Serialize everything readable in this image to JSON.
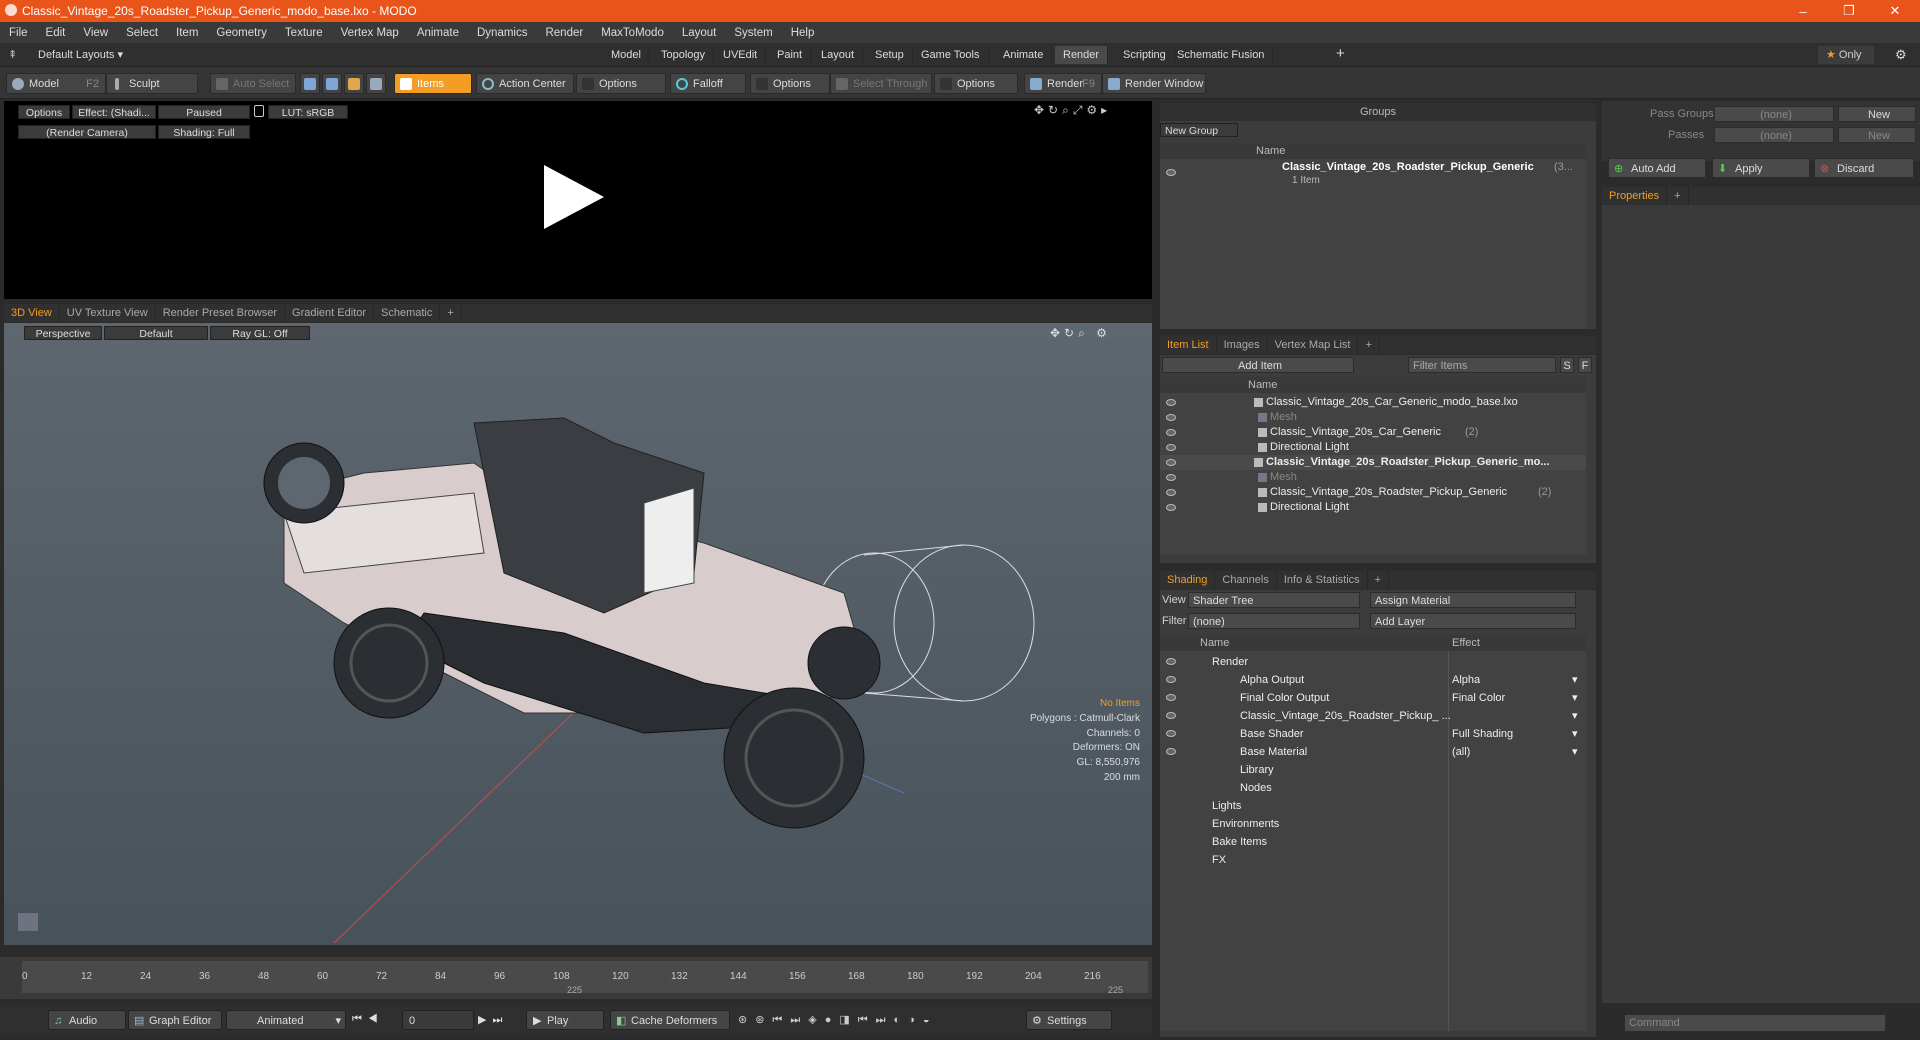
{
  "window": {
    "title": "Classic_Vintage_20s_Roadster_Pickup_Generic_modo_base.lxo - MODO",
    "minimize": "–",
    "restore": "❐",
    "close": "✕"
  },
  "menu": [
    "File",
    "Edit",
    "View",
    "Select",
    "Item",
    "Geometry",
    "Texture",
    "Vertex Map",
    "Animate",
    "Dynamics",
    "Render",
    "MaxToModo",
    "Layout",
    "System",
    "Help"
  ],
  "layouts": {
    "default": "Default Layouts ▾",
    "tabs": [
      "Model",
      "Topology",
      "UVEdit",
      "Paint",
      "Layout",
      "Setup",
      "Game Tools",
      "Animate",
      "Render",
      "Scripting",
      "Schematic Fusion"
    ],
    "active": "Render",
    "add": "+",
    "only": "Only"
  },
  "toolbar": {
    "model": "Model",
    "model_key": "F2",
    "sculpt": "Sculpt",
    "auto_select": "Auto Select",
    "items": "Items",
    "action_center": "Action Center",
    "options1": "Options",
    "falloff": "Falloff",
    "options2": "Options",
    "select_through": "Select Through",
    "options3": "Options",
    "render": "Render",
    "render_key": "F9",
    "render_window": "Render Window"
  },
  "render_preview": {
    "options": "Options",
    "effect": "Effect: (Shadi...",
    "paused": "Paused",
    "lut": "LUT: sRGB",
    "camera": "(Render Camera)",
    "shading": "Shading: Full"
  },
  "viewport_tabs": [
    "3D View",
    "UV Texture View",
    "Render Preset Browser",
    "Gradient Editor",
    "Schematic"
  ],
  "viewport": {
    "perspective": "Perspective",
    "default": "Default",
    "raygl": "Ray GL: Off",
    "no_items": "No Items",
    "polygons": "Polygons : Catmull-Clark",
    "channels": "Channels: 0",
    "deformers": "Deformers: ON",
    "gl": "GL: 8,550,976",
    "scale": "200 mm"
  },
  "groups": {
    "title": "Groups",
    "new_group": "New Group",
    "col_name": "Name",
    "item_name": "Classic_Vintage_20s_Roadster_Pickup_Generic",
    "item_suffix": "(3...",
    "item_count": "1 Item"
  },
  "pass": {
    "pass_groups": "Pass Groups",
    "passes": "Passes",
    "none1": "(none)",
    "none2": "(none)",
    "new1": "New",
    "new2": "New",
    "auto_add": "Auto Add",
    "apply": "Apply",
    "discard": "Discard",
    "properties": "Properties"
  },
  "itemlist": {
    "tabs": [
      "Item List",
      "Images",
      "Vertex Map List"
    ],
    "add_item": "Add Item",
    "filter": "Filter Items",
    "s": "S",
    "f": "F",
    "col_name": "Name",
    "rows": [
      {
        "label": "Classic_Vintage_20s_Car_Generic_modo_base.lxo",
        "indent": 0,
        "bold": false,
        "dim": false
      },
      {
        "label": "Mesh",
        "indent": 1,
        "bold": false,
        "dim": true
      },
      {
        "label": "Classic_Vintage_20s_Car_Generic",
        "suffix": "(2)",
        "indent": 1,
        "bold": false,
        "dim": false
      },
      {
        "label": "Directional Light",
        "indent": 1,
        "bold": false,
        "dim": false
      },
      {
        "label": "Classic_Vintage_20s_Roadster_Pickup_Generic_mo...",
        "indent": 0,
        "bold": true,
        "dim": false
      },
      {
        "label": "Mesh",
        "indent": 1,
        "bold": false,
        "dim": true
      },
      {
        "label": "Classic_Vintage_20s_Roadster_Pickup_Generic",
        "suffix": "(2)",
        "indent": 1,
        "bold": false,
        "dim": false
      },
      {
        "label": "Directional Light",
        "indent": 1,
        "bold": false,
        "dim": false
      }
    ]
  },
  "shading": {
    "tabs": [
      "Shading",
      "Channels",
      "Info & Statistics"
    ],
    "view_label": "View",
    "view_value": "Shader Tree",
    "assign": "Assign Material",
    "filter_label": "Filter",
    "filter_value": "(none)",
    "add_layer": "Add Layer",
    "col_name": "Name",
    "col_effect": "Effect",
    "rows": [
      {
        "label": "Render",
        "effect": ""
      },
      {
        "label": "Alpha Output",
        "effect": "Alpha"
      },
      {
        "label": "Final Color Output",
        "effect": "Final Color"
      },
      {
        "label": "Classic_Vintage_20s_Roadster_Pickup_ ...",
        "effect": ""
      },
      {
        "label": "Base Shader",
        "effect": "Full Shading"
      },
      {
        "label": "Base Material",
        "effect": "(all)"
      },
      {
        "label": "Library",
        "effect": ""
      },
      {
        "label": "Nodes",
        "effect": ""
      },
      {
        "label": "Lights",
        "effect": ""
      },
      {
        "label": "Environments",
        "effect": ""
      },
      {
        "label": "Bake Items",
        "effect": ""
      },
      {
        "label": "FX",
        "effect": ""
      }
    ]
  },
  "timeline": {
    "ticks": [
      "0",
      "12",
      "24",
      "36",
      "48",
      "60",
      "72",
      "84",
      "96",
      "108",
      "120",
      "132",
      "144",
      "156",
      "168",
      "180",
      "192",
      "204",
      "216"
    ],
    "end": "225",
    "mid": "225"
  },
  "bottom": {
    "audio": "Audio",
    "graph_editor": "Graph Editor",
    "animated": "Animated",
    "frame": "0",
    "play": "Play",
    "cache": "Cache Deformers",
    "settings": "Settings",
    "command": "Command"
  }
}
